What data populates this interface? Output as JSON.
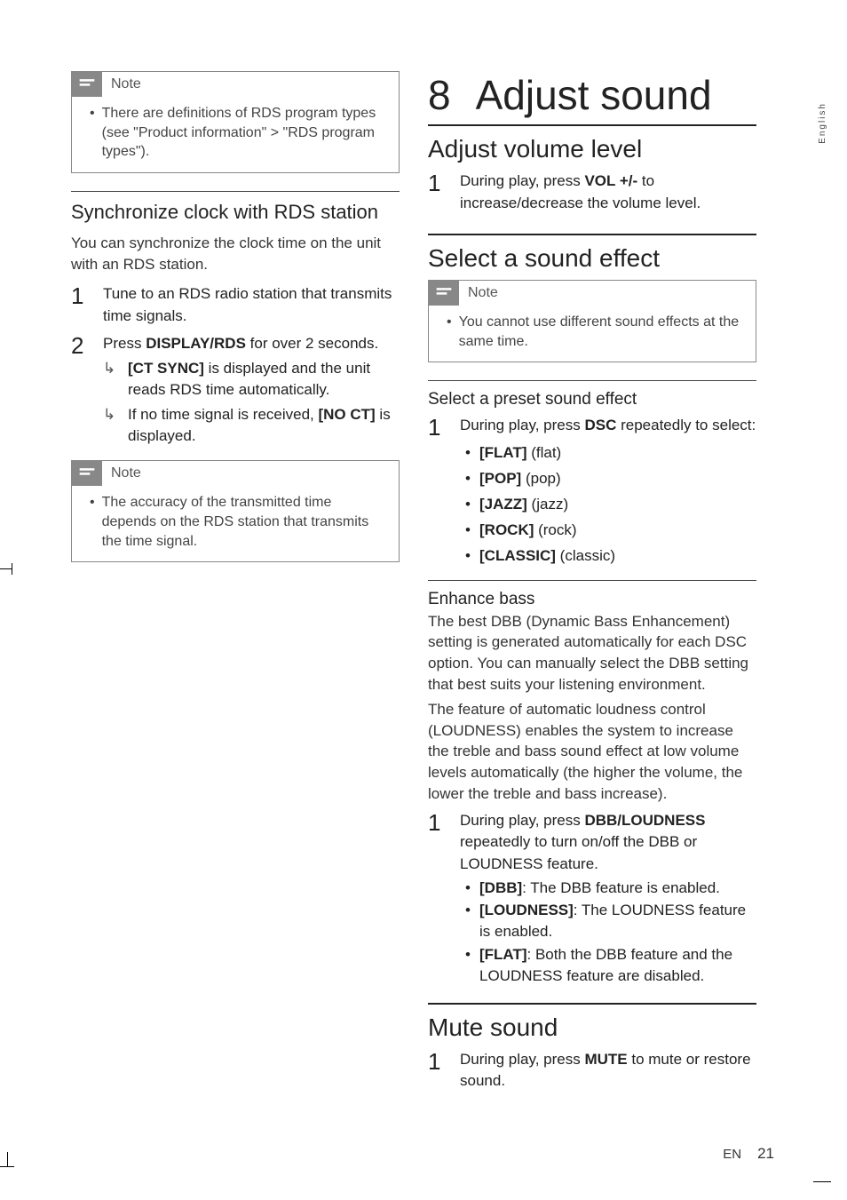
{
  "sideTab": "English",
  "footer": {
    "lang": "EN",
    "page": "21"
  },
  "left": {
    "note1": {
      "label": "Note",
      "text": "There are definitions of RDS program types (see \"Product information\" > \"RDS program types\")."
    },
    "syncTitle": "Synchronize clock with RDS station",
    "syncIntro": "You can synchronize the clock time on the unit with an RDS station.",
    "step1": {
      "num": "1",
      "text": "Tune to an RDS radio station that transmits time signals."
    },
    "step2": {
      "num": "2",
      "pre": "Press ",
      "bold": "DISPLAY/RDS",
      "post": " for over 2 seconds.",
      "r1_b": "[CT SYNC]",
      "r1_t": " is displayed and the unit reads RDS time automatically.",
      "r2_pre": "If no time signal is received, ",
      "r2_b": "[NO CT]",
      "r2_post": " is displayed."
    },
    "note2": {
      "label": "Note",
      "text": "The accuracy of the transmitted time depends on the RDS station that transmits the time signal."
    }
  },
  "right": {
    "chapterNum": "8",
    "chapterTitle": "Adjust sound",
    "vol": {
      "title": "Adjust volume level",
      "stepNum": "1",
      "pre": "During play, press ",
      "bold": "VOL +/-",
      "post": " to increase/decrease the volume level."
    },
    "sel": {
      "title": "Select a sound effect",
      "noteLabel": "Note",
      "noteText": "You cannot use different sound effects at the same time.",
      "presetTitle": "Select a preset sound effect",
      "stepNum": "1",
      "pre": "During play, press ",
      "bold": "DSC",
      "post": " repeatedly to select:",
      "opts": [
        {
          "b": "[FLAT]",
          "t": " (flat)"
        },
        {
          "b": "[POP]",
          "t": " (pop)"
        },
        {
          "b": "[JAZZ]",
          "t": " (jazz)"
        },
        {
          "b": "[ROCK]",
          "t": " (rock)"
        },
        {
          "b": "[CLASSIC]",
          "t": " (classic)"
        }
      ]
    },
    "bass": {
      "title": "Enhance bass",
      "p1": "The best DBB (Dynamic Bass Enhancement) setting is generated automatically for each DSC option. You can manually select the DBB setting that best suits your listening environment.",
      "p2": "The feature of automatic loudness control (LOUDNESS) enables the system to increase the treble and bass sound effect at low volume levels automatically (the higher the volume, the lower the treble and bass increase).",
      "stepNum": "1",
      "pre": "During play, press ",
      "bold": "DBB/LOUDNESS",
      "post": " repeatedly to turn on/off the DBB or LOUDNESS feature.",
      "res": [
        {
          "b": "[DBB]",
          "t": ": The DBB feature is enabled."
        },
        {
          "b": "[LOUDNESS]",
          "t": ": The LOUDNESS feature is enabled."
        },
        {
          "b": "[FLAT]",
          "t": ": Both the DBB feature and the LOUDNESS feature are disabled."
        }
      ]
    },
    "mute": {
      "title": "Mute sound",
      "stepNum": "1",
      "pre": "During play, press ",
      "bold": "MUTE",
      "post": " to mute or restore sound."
    }
  }
}
